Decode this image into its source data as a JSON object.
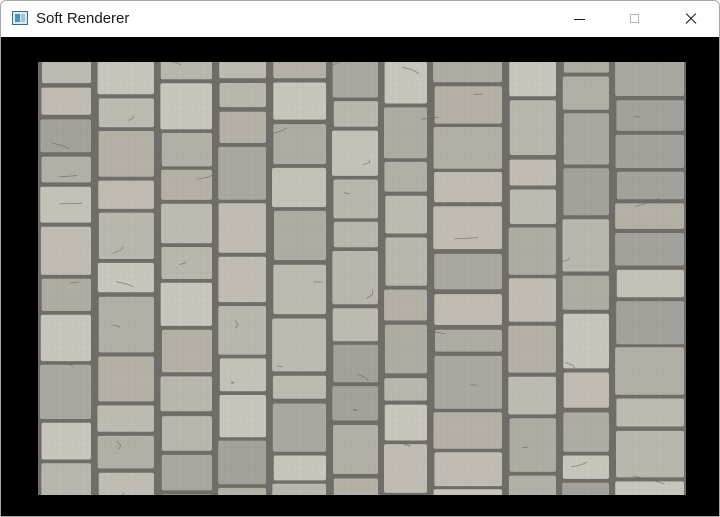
{
  "window": {
    "title": "Soft Renderer",
    "app_icon": "app-window-icon",
    "controls": {
      "minimize_icon": "minimize-icon",
      "maximize_icon": "maximize-icon",
      "close_icon": "close-icon"
    }
  },
  "viewport": {
    "content": "stone-paving-texture",
    "background_color": "#000000"
  }
}
